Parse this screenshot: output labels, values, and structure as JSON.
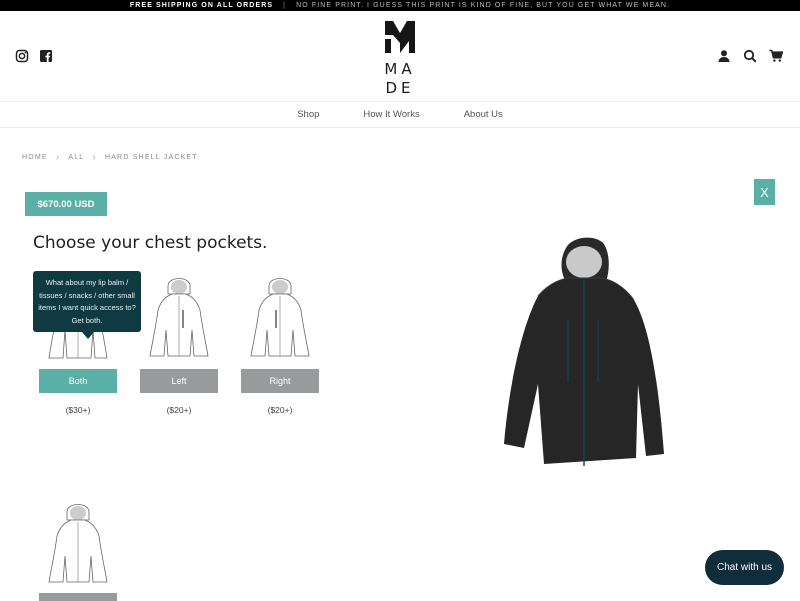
{
  "announcement": {
    "primary": "FREE SHIPPING ON ALL ORDERS",
    "divider": "|",
    "secondary": "NO FINE PRINT. I GUESS THIS PRINT IS KIND OF FINE, BUT YOU GET WHAT WE MEAN."
  },
  "header": {
    "logo_line1": "MA",
    "logo_line2": "DE",
    "social": [
      "instagram-icon",
      "facebook-icon"
    ],
    "user_icons": [
      "account-icon",
      "search-icon",
      "cart-icon"
    ]
  },
  "nav": {
    "items": [
      "Shop",
      "How It Works",
      "About Us"
    ]
  },
  "breadcrumb": {
    "items": [
      "HOME",
      "ALL",
      "HARD SHELL JACKET"
    ]
  },
  "price": "$670.00 USD",
  "close_label": "X",
  "heading": "Choose your chest pockets.",
  "tooltip": "What about my lip balm / tissues / snacks / other small items I want quick access to? Get both.",
  "options": [
    {
      "label": "Both",
      "price": "($30+)"
    },
    {
      "label": "Left",
      "price": "($20+)"
    },
    {
      "label": "Right",
      "price": "($20+)"
    }
  ],
  "chat": "Chat with us",
  "colors": {
    "accent": "#5ab0a6",
    "dark": "#0f3a42",
    "inactive": "#999a9b"
  }
}
